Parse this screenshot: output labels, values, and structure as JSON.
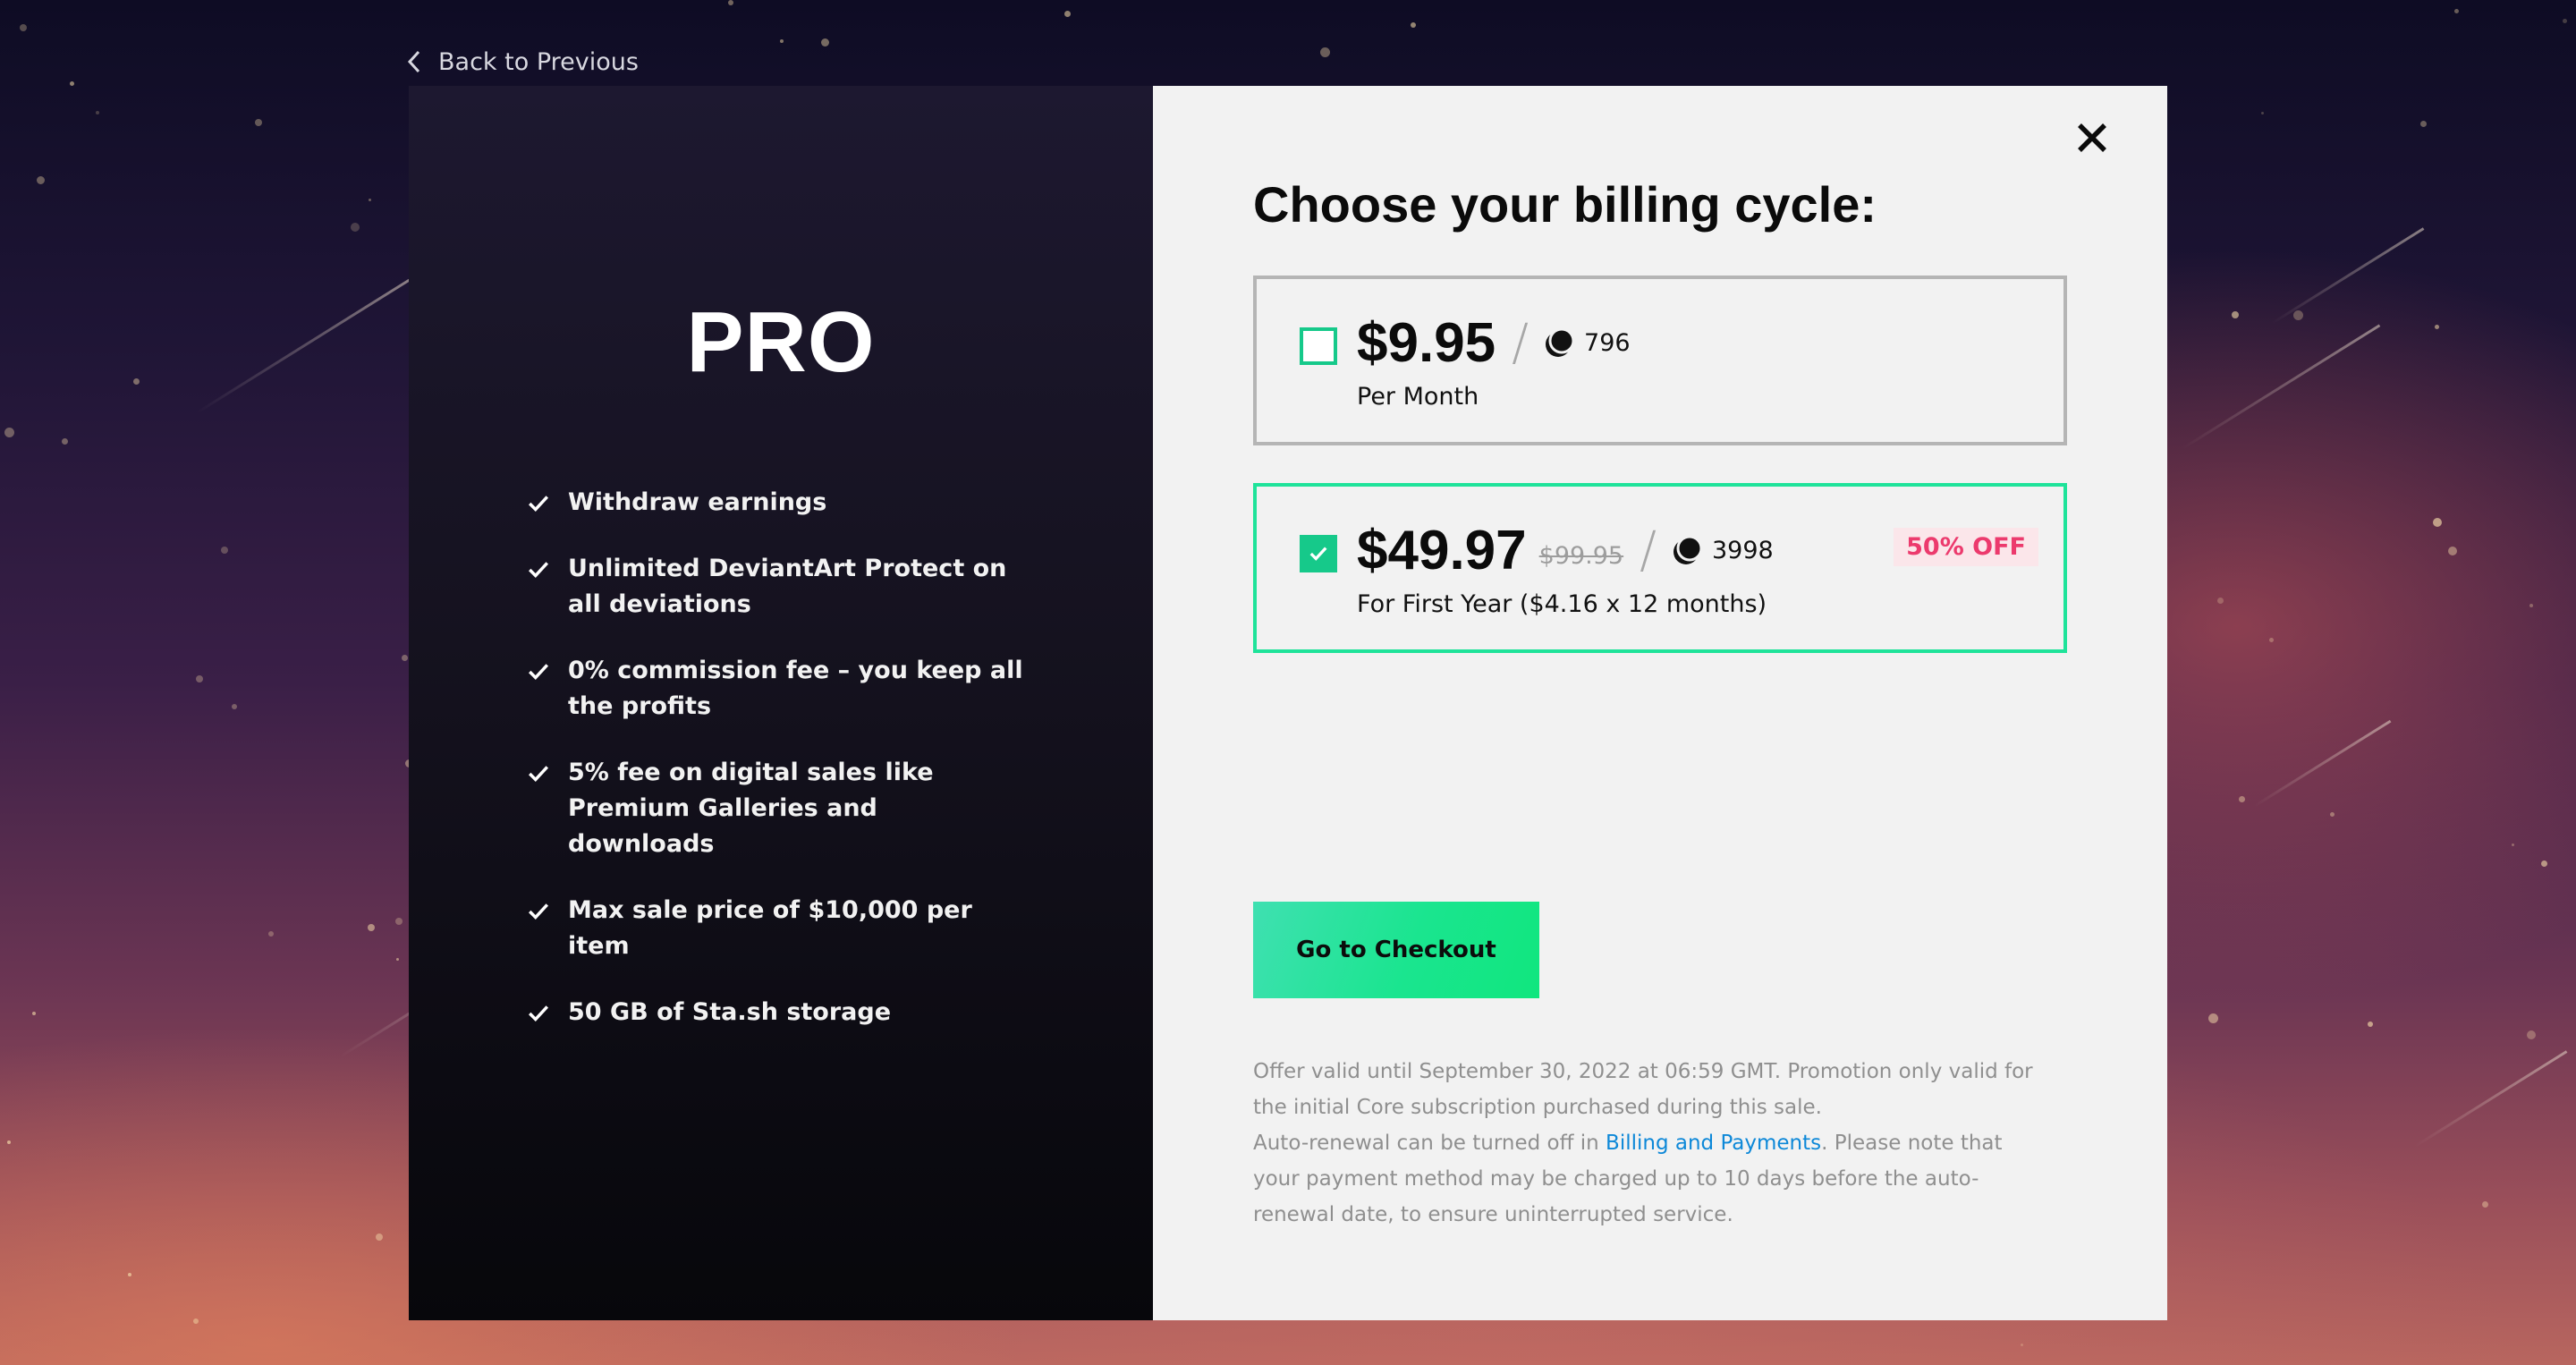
{
  "back_link": {
    "label": "Back to Previous",
    "icon": "chevron-left-icon"
  },
  "plan": {
    "title": "PRO",
    "features": [
      "Withdraw earnings",
      "Unlimited DeviantArt Protect on all deviations",
      "0% commission fee – you keep all the profits",
      "5% fee on digital sales like Premium Galleries and downloads",
      "Max sale price of $10,000 per item",
      "50 GB of Sta.sh storage"
    ]
  },
  "billing": {
    "heading": "Choose your billing cycle:",
    "options": [
      {
        "price": "$9.95",
        "old_price": "",
        "points": "796",
        "period": "Per Month",
        "discount": "",
        "selected": false
      },
      {
        "price": "$49.97",
        "old_price": "$99.95",
        "points": "3998",
        "period": "For First Year ($4.16 x 12 months)",
        "discount": "50% OFF",
        "selected": true
      }
    ],
    "checkout_label": "Go to Checkout",
    "fine_print": {
      "line1": "Offer valid until September 30, 2022 at 06:59 GMT. Promotion only valid for the initial Core subscription purchased during this sale.",
      "line2_pre": "Auto-renewal can be turned off in ",
      "link": "Billing and Payments",
      "line2_post": ". Please note that your payment method may be charged up to 10 days before the auto-renewal date, to ensure uninterrupted service."
    }
  },
  "colors": {
    "accent_green": "#1fe39a",
    "checkbox_green": "#16c98a",
    "discount_pink": "#ec3a6d",
    "link_blue": "#0d88d8"
  }
}
